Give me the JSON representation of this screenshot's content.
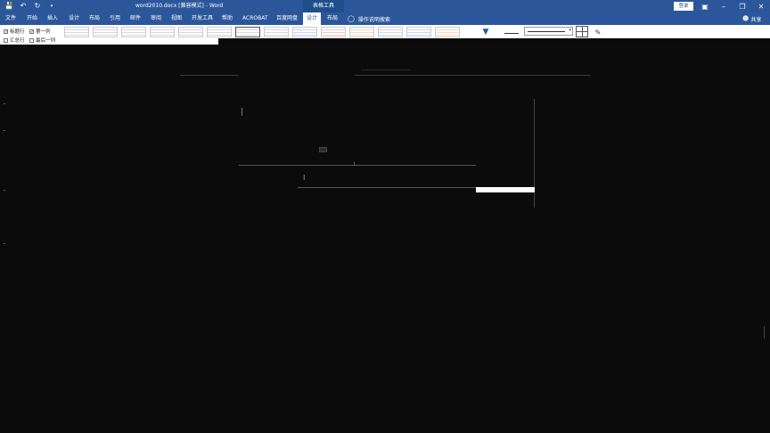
{
  "titlebar": {
    "doc_title": "word2010.docx [兼容模式] - Word",
    "context_tools": "表格工具",
    "login": "登录",
    "icons": [
      "save-icon",
      "undo-icon",
      "redo-icon",
      "customize-qat-icon",
      "ribbon-display-icon",
      "minimize-icon",
      "restore-icon",
      "close-icon"
    ]
  },
  "tabs": {
    "file": "文件",
    "home": "开始",
    "insert": "插入",
    "design_doc": "设计",
    "layout": "布局",
    "references": "引用",
    "mailings": "邮件",
    "review": "审阅",
    "view": "视图",
    "developer": "开发工具",
    "help": "帮助",
    "acrobat": "ACROBAT",
    "baidu": "百度网盘",
    "table_design": "设计",
    "table_layout": "布局",
    "tellme": "操作说明搜索",
    "share": "共享"
  },
  "ribbon": {
    "header_row": "标题行",
    "first_column": "第一列",
    "total_row": "汇总行",
    "last_column": "最后一列",
    "header_row_checked": "✓",
    "first_column_checked": "✓"
  }
}
